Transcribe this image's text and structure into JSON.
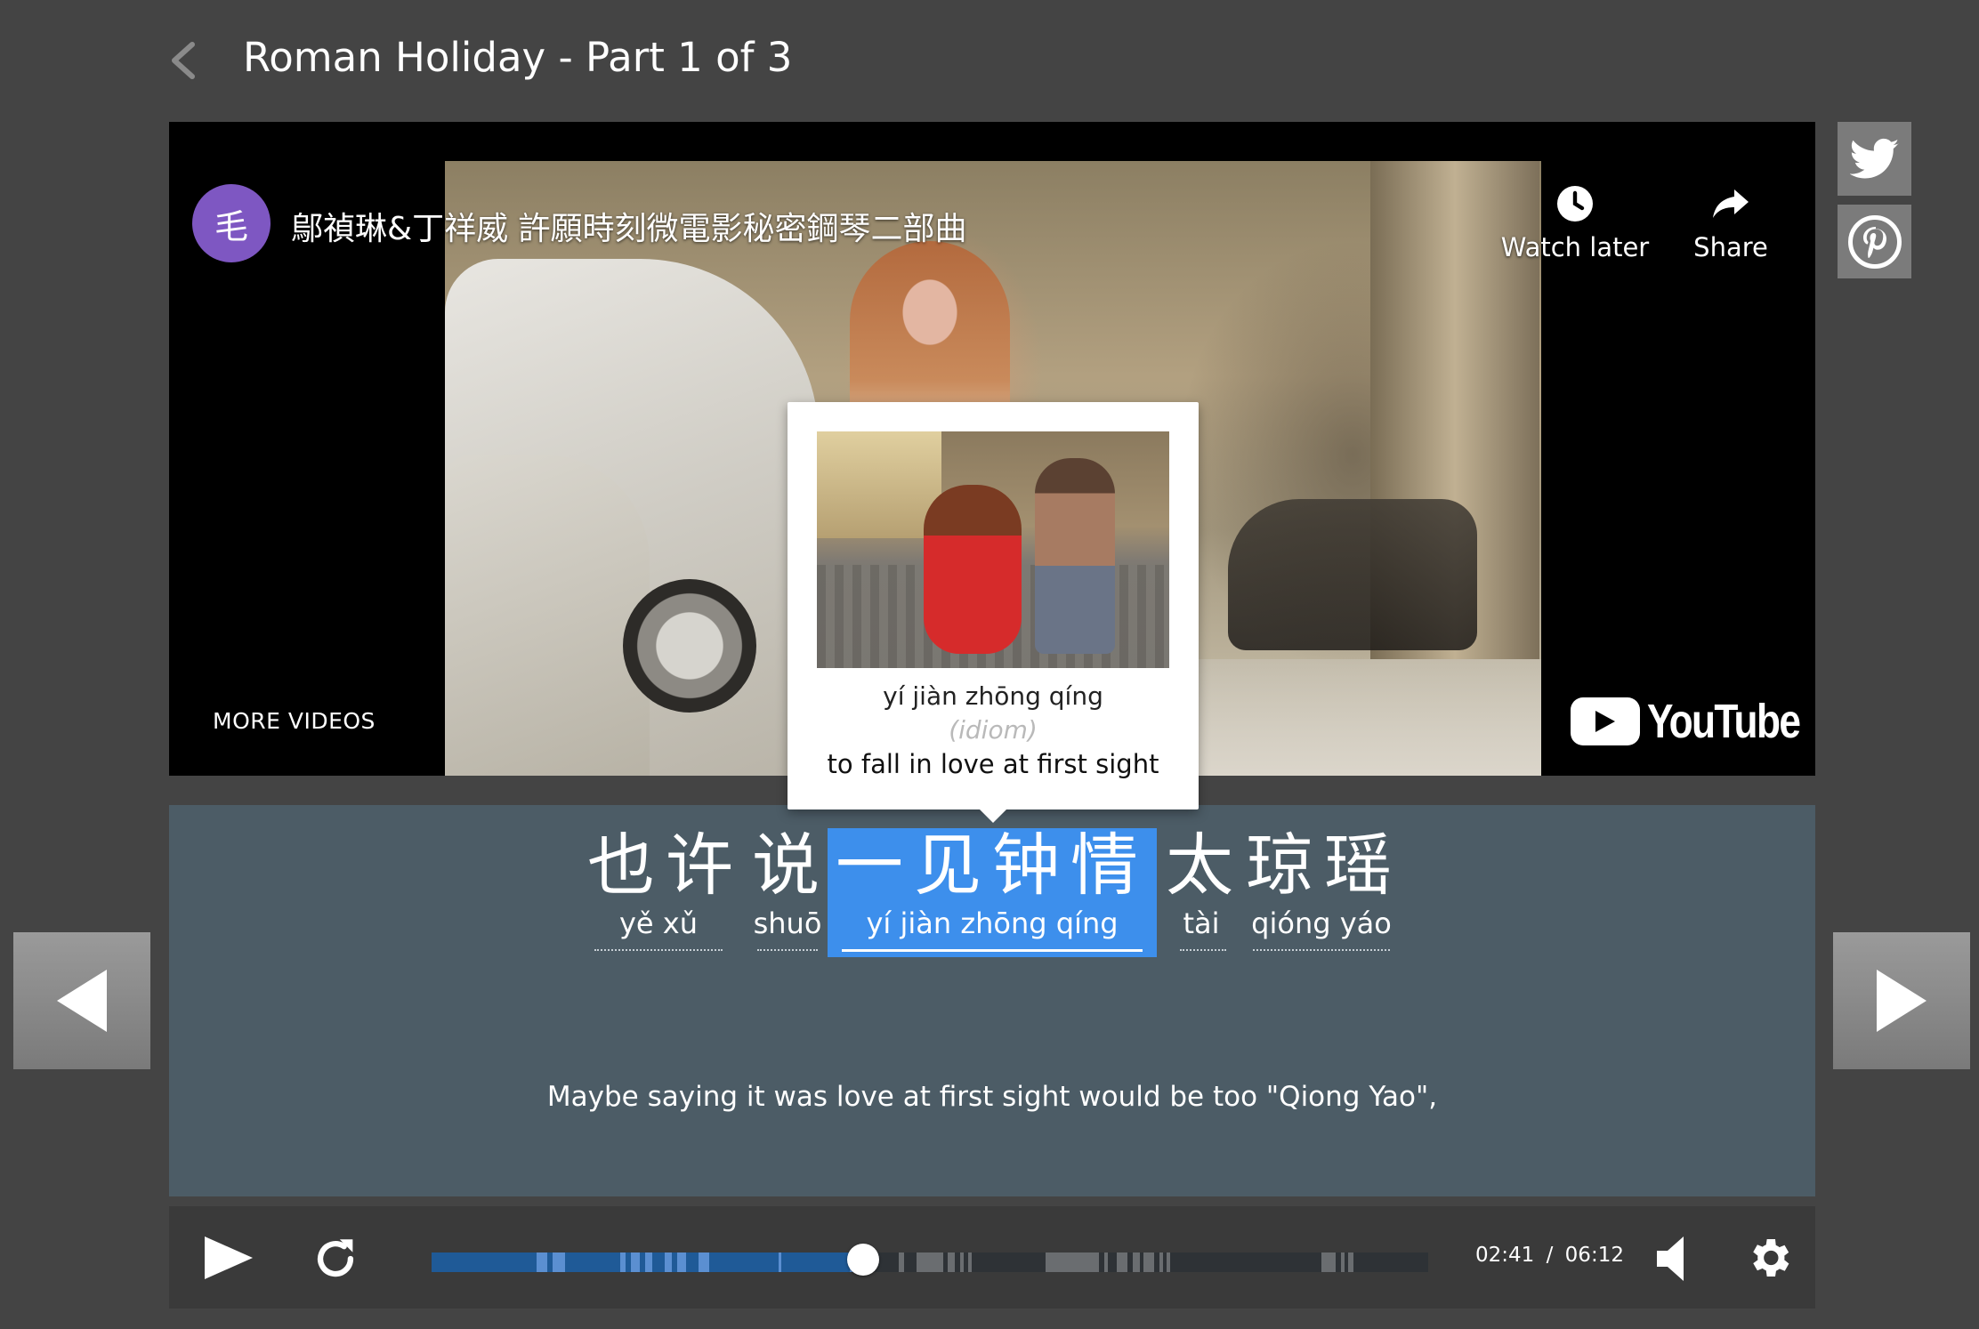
{
  "header": {
    "title": "Roman Holiday - Part 1 of 3"
  },
  "video": {
    "channel_initial": "毛",
    "title": "鄔禎琳&丁祥威 許願時刻微電影秘密鋼琴二部曲",
    "watch_later_label": "Watch later",
    "share_label": "Share",
    "more_videos_label": "MORE VIDEOS",
    "youtube_label": "YouTube"
  },
  "popup": {
    "pinyin": "yí jiàn zhōng qíng",
    "part_of_speech": "(idiom)",
    "meaning": "to fall in love at first sight"
  },
  "subtitle": {
    "words": [
      {
        "hanzi": "也许",
        "pinyin": "yě xǔ",
        "active": false
      },
      {
        "hanzi": "说",
        "pinyin": "shuō",
        "active": false
      },
      {
        "hanzi": "一见钟情",
        "pinyin": "yí jiàn zhōng qíng",
        "active": true
      },
      {
        "hanzi": "太",
        "pinyin": "tài",
        "active": false
      },
      {
        "hanzi": "琼瑶",
        "pinyin": "qióng yáo",
        "active": false
      }
    ],
    "translation": "Maybe saying it was love at first sight would be too \"Qiong Yao\","
  },
  "player": {
    "current_time": "02:41",
    "separator": "/",
    "duration": "06:12",
    "progress_fraction": 0.433
  },
  "colors": {
    "background": "#444444",
    "subtitle_panel": "#4c5c66",
    "highlight": "#3d8fec",
    "progress": "#1f5a97",
    "avatar": "#7e57c2"
  }
}
